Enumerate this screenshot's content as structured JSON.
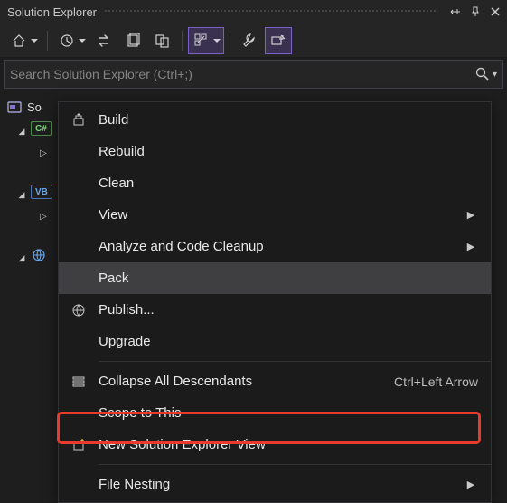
{
  "titlebar": {
    "title": "Solution Explorer"
  },
  "search": {
    "placeholder": "Search Solution Explorer (Ctrl+;)"
  },
  "tree": {
    "solution_prefix": "So",
    "csBadge": "C#",
    "vbBadge": "VB"
  },
  "menu": {
    "build": "Build",
    "rebuild": "Rebuild",
    "clean": "Clean",
    "view": "View",
    "analyze": "Analyze and Code Cleanup",
    "pack": "Pack",
    "publish": "Publish...",
    "upgrade": "Upgrade",
    "collapse": "Collapse All Descendants",
    "collapseShortcut": "Ctrl+Left Arrow",
    "scope": "Scope to This",
    "newview": "New Solution Explorer View",
    "nesting": "File Nesting"
  }
}
